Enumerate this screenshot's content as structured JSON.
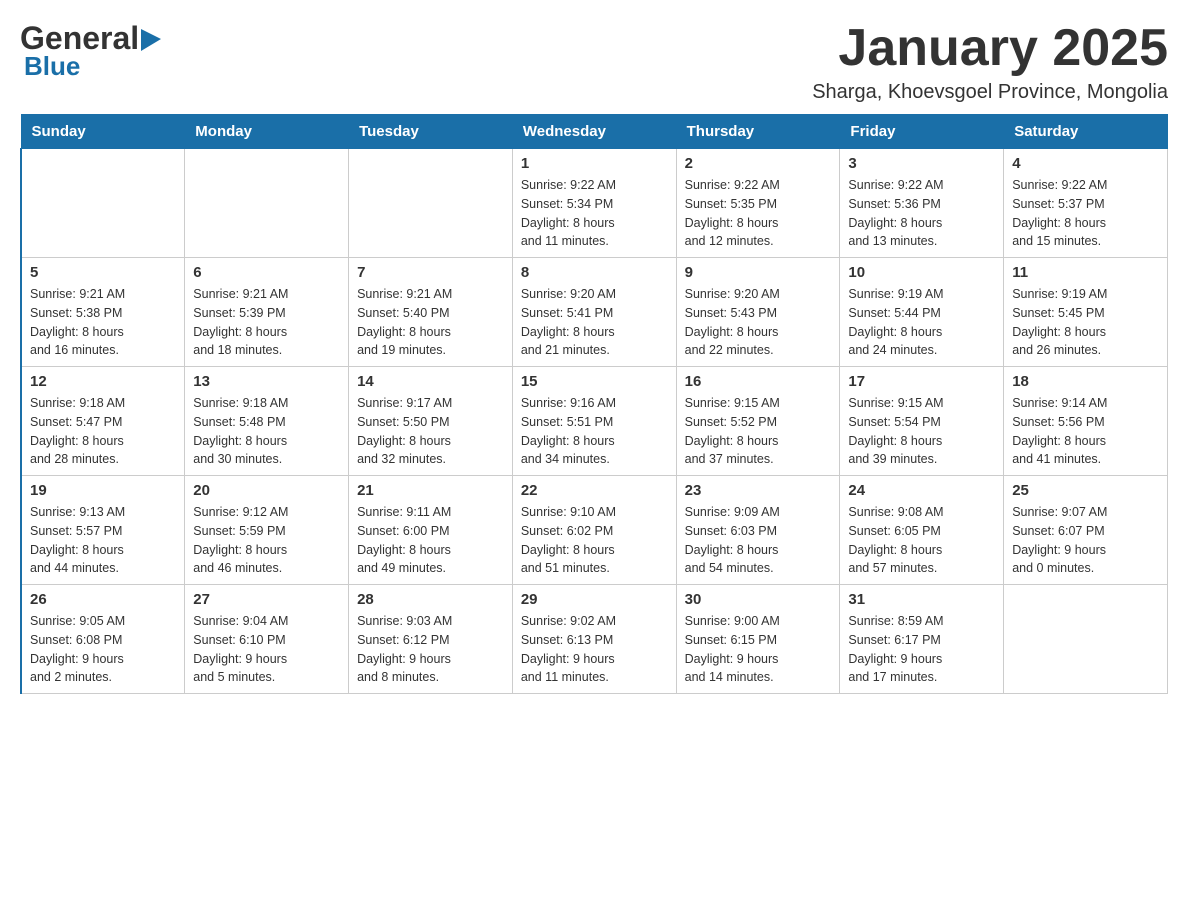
{
  "header": {
    "logo_general": "General",
    "logo_blue": "Blue",
    "title": "January 2025",
    "subtitle": "Sharga, Khoevsgoel Province, Mongolia"
  },
  "days_of_week": [
    "Sunday",
    "Monday",
    "Tuesday",
    "Wednesday",
    "Thursday",
    "Friday",
    "Saturday"
  ],
  "weeks": [
    [
      {
        "day": "",
        "info": ""
      },
      {
        "day": "",
        "info": ""
      },
      {
        "day": "",
        "info": ""
      },
      {
        "day": "1",
        "info": "Sunrise: 9:22 AM\nSunset: 5:34 PM\nDaylight: 8 hours\nand 11 minutes."
      },
      {
        "day": "2",
        "info": "Sunrise: 9:22 AM\nSunset: 5:35 PM\nDaylight: 8 hours\nand 12 minutes."
      },
      {
        "day": "3",
        "info": "Sunrise: 9:22 AM\nSunset: 5:36 PM\nDaylight: 8 hours\nand 13 minutes."
      },
      {
        "day": "4",
        "info": "Sunrise: 9:22 AM\nSunset: 5:37 PM\nDaylight: 8 hours\nand 15 minutes."
      }
    ],
    [
      {
        "day": "5",
        "info": "Sunrise: 9:21 AM\nSunset: 5:38 PM\nDaylight: 8 hours\nand 16 minutes."
      },
      {
        "day": "6",
        "info": "Sunrise: 9:21 AM\nSunset: 5:39 PM\nDaylight: 8 hours\nand 18 minutes."
      },
      {
        "day": "7",
        "info": "Sunrise: 9:21 AM\nSunset: 5:40 PM\nDaylight: 8 hours\nand 19 minutes."
      },
      {
        "day": "8",
        "info": "Sunrise: 9:20 AM\nSunset: 5:41 PM\nDaylight: 8 hours\nand 21 minutes."
      },
      {
        "day": "9",
        "info": "Sunrise: 9:20 AM\nSunset: 5:43 PM\nDaylight: 8 hours\nand 22 minutes."
      },
      {
        "day": "10",
        "info": "Sunrise: 9:19 AM\nSunset: 5:44 PM\nDaylight: 8 hours\nand 24 minutes."
      },
      {
        "day": "11",
        "info": "Sunrise: 9:19 AM\nSunset: 5:45 PM\nDaylight: 8 hours\nand 26 minutes."
      }
    ],
    [
      {
        "day": "12",
        "info": "Sunrise: 9:18 AM\nSunset: 5:47 PM\nDaylight: 8 hours\nand 28 minutes."
      },
      {
        "day": "13",
        "info": "Sunrise: 9:18 AM\nSunset: 5:48 PM\nDaylight: 8 hours\nand 30 minutes."
      },
      {
        "day": "14",
        "info": "Sunrise: 9:17 AM\nSunset: 5:50 PM\nDaylight: 8 hours\nand 32 minutes."
      },
      {
        "day": "15",
        "info": "Sunrise: 9:16 AM\nSunset: 5:51 PM\nDaylight: 8 hours\nand 34 minutes."
      },
      {
        "day": "16",
        "info": "Sunrise: 9:15 AM\nSunset: 5:52 PM\nDaylight: 8 hours\nand 37 minutes."
      },
      {
        "day": "17",
        "info": "Sunrise: 9:15 AM\nSunset: 5:54 PM\nDaylight: 8 hours\nand 39 minutes."
      },
      {
        "day": "18",
        "info": "Sunrise: 9:14 AM\nSunset: 5:56 PM\nDaylight: 8 hours\nand 41 minutes."
      }
    ],
    [
      {
        "day": "19",
        "info": "Sunrise: 9:13 AM\nSunset: 5:57 PM\nDaylight: 8 hours\nand 44 minutes."
      },
      {
        "day": "20",
        "info": "Sunrise: 9:12 AM\nSunset: 5:59 PM\nDaylight: 8 hours\nand 46 minutes."
      },
      {
        "day": "21",
        "info": "Sunrise: 9:11 AM\nSunset: 6:00 PM\nDaylight: 8 hours\nand 49 minutes."
      },
      {
        "day": "22",
        "info": "Sunrise: 9:10 AM\nSunset: 6:02 PM\nDaylight: 8 hours\nand 51 minutes."
      },
      {
        "day": "23",
        "info": "Sunrise: 9:09 AM\nSunset: 6:03 PM\nDaylight: 8 hours\nand 54 minutes."
      },
      {
        "day": "24",
        "info": "Sunrise: 9:08 AM\nSunset: 6:05 PM\nDaylight: 8 hours\nand 57 minutes."
      },
      {
        "day": "25",
        "info": "Sunrise: 9:07 AM\nSunset: 6:07 PM\nDaylight: 9 hours\nand 0 minutes."
      }
    ],
    [
      {
        "day": "26",
        "info": "Sunrise: 9:05 AM\nSunset: 6:08 PM\nDaylight: 9 hours\nand 2 minutes."
      },
      {
        "day": "27",
        "info": "Sunrise: 9:04 AM\nSunset: 6:10 PM\nDaylight: 9 hours\nand 5 minutes."
      },
      {
        "day": "28",
        "info": "Sunrise: 9:03 AM\nSunset: 6:12 PM\nDaylight: 9 hours\nand 8 minutes."
      },
      {
        "day": "29",
        "info": "Sunrise: 9:02 AM\nSunset: 6:13 PM\nDaylight: 9 hours\nand 11 minutes."
      },
      {
        "day": "30",
        "info": "Sunrise: 9:00 AM\nSunset: 6:15 PM\nDaylight: 9 hours\nand 14 minutes."
      },
      {
        "day": "31",
        "info": "Sunrise: 8:59 AM\nSunset: 6:17 PM\nDaylight: 9 hours\nand 17 minutes."
      },
      {
        "day": "",
        "info": ""
      }
    ]
  ]
}
